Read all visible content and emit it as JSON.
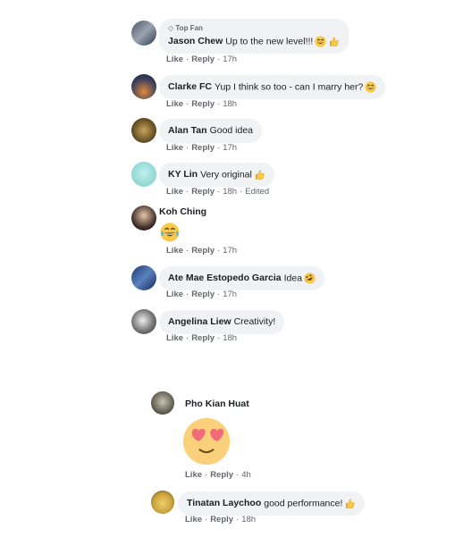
{
  "comments": [
    {
      "badge": "Top Fan",
      "name": "Jason Chew",
      "text": "Up to the new level!!!",
      "emojis": [
        "grin-squint-icon",
        "thumbs-up-icon"
      ],
      "like": "Like",
      "reply": "Reply",
      "time": "17h"
    },
    {
      "name": "Clarke FC",
      "text": "Yup I think so too - can I marry her?",
      "emojis": [
        "grin-squint-icon"
      ],
      "like": "Like",
      "reply": "Reply",
      "time": "18h"
    },
    {
      "name": "Alan Tan",
      "text": "Good idea",
      "emojis": [],
      "like": "Like",
      "reply": "Reply",
      "time": "17h"
    },
    {
      "name": "KY Lin",
      "text": "Very original",
      "emojis": [
        "thumbs-up-icon"
      ],
      "like": "Like",
      "reply": "Reply",
      "time": "18h",
      "edited": "Edited"
    },
    {
      "name": "Koh Ching",
      "text": "",
      "emojis": [
        "tears-of-joy-icon"
      ],
      "like": "Like",
      "reply": "Reply",
      "time": "17h"
    },
    {
      "name": "Ate Mae Estopedo Garcia",
      "text": "Idea",
      "emojis": [
        "rolling-laugh-icon"
      ],
      "like": "Like",
      "reply": "Reply",
      "time": "17h"
    },
    {
      "name": "Angelina Liew",
      "text": "Creativity!",
      "emojis": [],
      "like": "Like",
      "reply": "Reply",
      "time": "18h"
    }
  ],
  "replies": [
    {
      "name": "Pho Kian Huat",
      "text": "",
      "emojis": [
        "heart-eyes-icon"
      ],
      "like": "Like",
      "reply": "Reply",
      "time": "4h"
    },
    {
      "name": "Tinatan Laychoo",
      "text": "good performance!",
      "emojis": [
        "thumbs-up-icon"
      ],
      "like": "Like",
      "reply": "Reply",
      "time": "18h"
    }
  ],
  "colors": {
    "bubble": "#f0f2f5",
    "meta": "#65676b",
    "emoji": "#f7c948"
  }
}
